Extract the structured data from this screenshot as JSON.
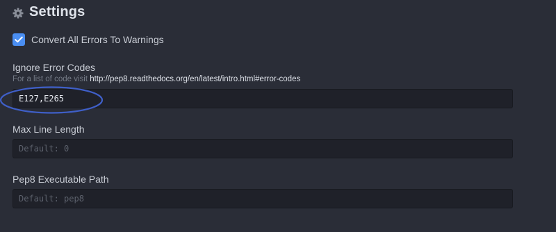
{
  "header": {
    "icon": "gear-icon",
    "title": "Settings"
  },
  "convert_errors": {
    "checked": true,
    "label": "Convert All Errors To Warnings"
  },
  "ignore_error_codes": {
    "label": "Ignore Error Codes",
    "description_prefix": "For a list of code visit ",
    "description_link": "http://pep8.readthedocs.org/en/latest/intro.html#error-codes",
    "value": "E127,E265"
  },
  "max_line_length": {
    "label": "Max Line Length",
    "placeholder": "Default: 0"
  },
  "pep8_path": {
    "label": "Pep8 Executable Path",
    "placeholder": "Default: pep8"
  },
  "colors": {
    "background": "#2a2d37",
    "input_background": "#1f2129",
    "accent": "#4a8ef2",
    "annotation": "#3f5fc8"
  }
}
